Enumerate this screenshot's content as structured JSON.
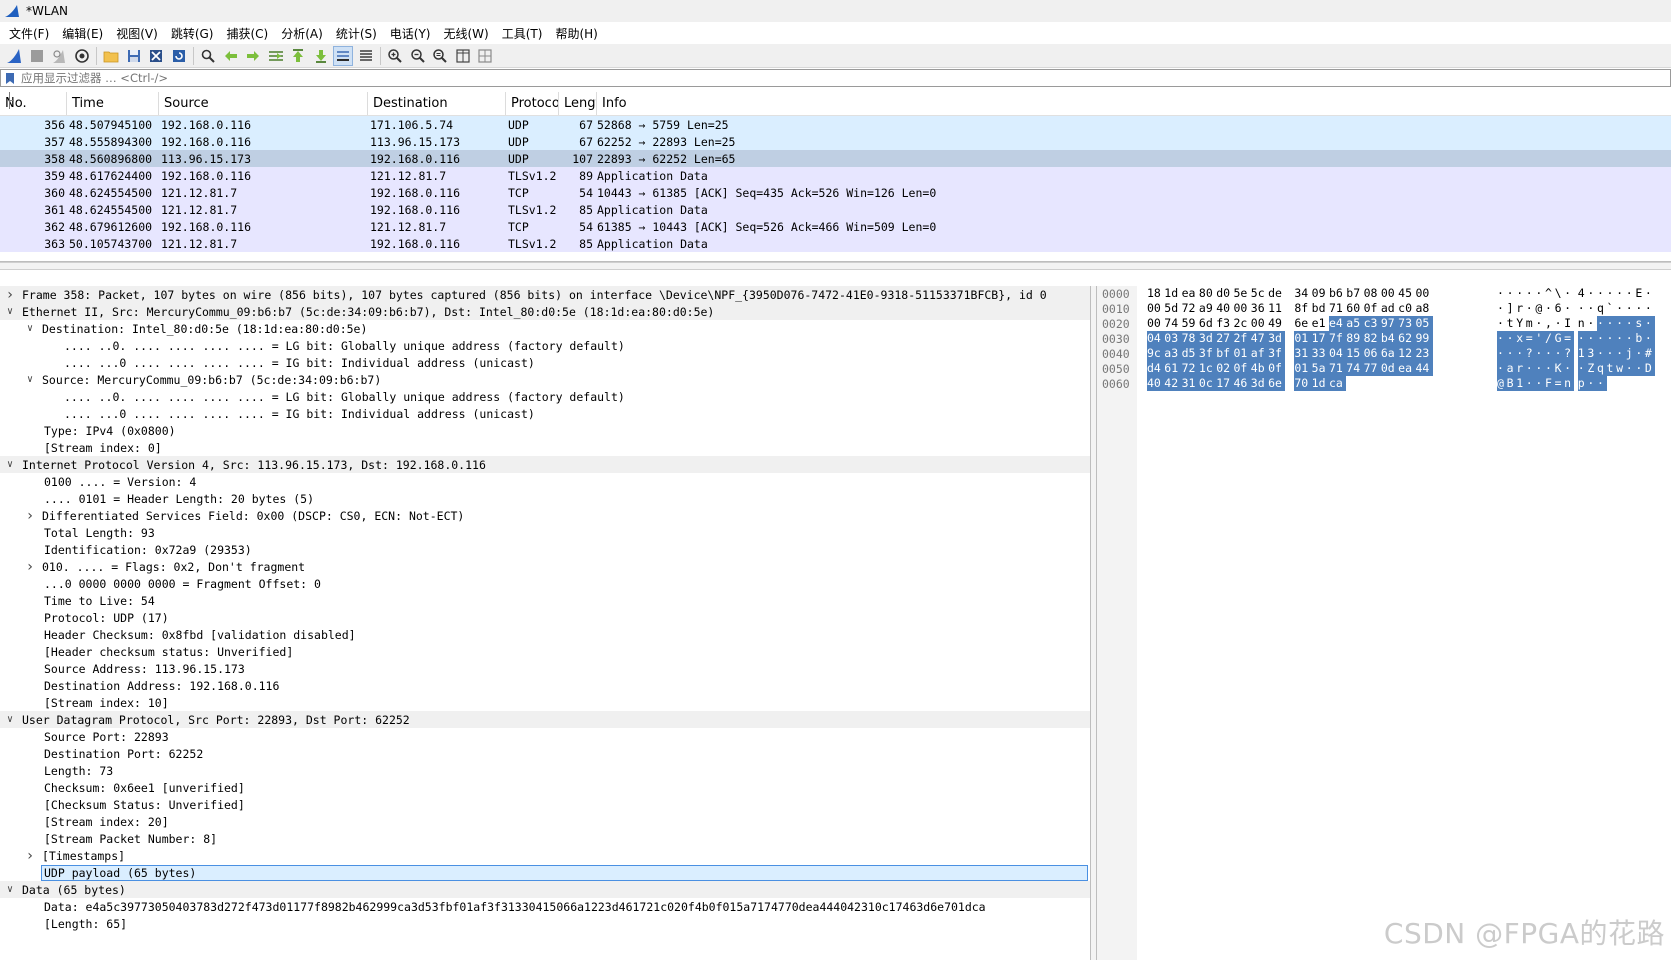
{
  "window": {
    "title": "*WLAN"
  },
  "menu": [
    "文件(F)",
    "编辑(E)",
    "视图(V)",
    "跳转(G)",
    "捕获(C)",
    "分析(A)",
    "统计(S)",
    "电话(Y)",
    "无线(W)",
    "工具(T)",
    "帮助(H)"
  ],
  "toolbar": {
    "icons": [
      "shark-fin-start-icon",
      "stop-square-icon",
      "restart-fin-icon",
      "capture-options-gear-icon",
      "open-folder-icon",
      "save-file-icon",
      "close-file-icon",
      "reload-file-icon",
      "find-packet-magnifier-icon",
      "go-back-arrow-icon",
      "go-forward-arrow-icon",
      "go-to-packet-icon",
      "go-first-packet-icon",
      "go-last-packet-icon",
      "autoscroll-icon",
      "colorize-icon",
      "zoom-in-icon",
      "zoom-out-icon",
      "normal-size-icon",
      "resize-columns-icon",
      "expand-columns-icon"
    ]
  },
  "filter": {
    "placeholder": "应用显示过滤器 … <Ctrl-/>"
  },
  "packet_list": {
    "columns": [
      "No.",
      "Time",
      "Source",
      "Destination",
      "Protoco",
      "Lengt",
      "Info"
    ],
    "rows": [
      {
        "no": "356",
        "time": "48.507945100",
        "src": "192.168.0.116",
        "dst": "171.106.5.74",
        "proto": "UDP",
        "len": "67",
        "info": "52868 → 5759 Len=25",
        "kind": "udp",
        "rel": "line"
      },
      {
        "no": "357",
        "time": "48.555894300",
        "src": "192.168.0.116",
        "dst": "113.96.15.173",
        "proto": "UDP",
        "len": "67",
        "info": "62252 → 22893 Len=25",
        "kind": "udp",
        "rel": "line"
      },
      {
        "no": "358",
        "time": "48.560896800",
        "src": "113.96.15.173",
        "dst": "192.168.0.116",
        "proto": "UDP",
        "len": "107",
        "info": "22893 → 62252 Len=65",
        "kind": "sel",
        "rel": "end"
      },
      {
        "no": "359",
        "time": "48.617624400",
        "src": "192.168.0.116",
        "dst": "121.12.81.7",
        "proto": "TLSv1.2",
        "len": "89",
        "info": "Application Data",
        "kind": "tcp",
        "rel": ""
      },
      {
        "no": "360",
        "time": "48.624554500",
        "src": "121.12.81.7",
        "dst": "192.168.0.116",
        "proto": "TCP",
        "len": "54",
        "info": "10443 → 61385 [ACK] Seq=435 Ack=526 Win=126 Len=0",
        "kind": "tcp",
        "rel": ""
      },
      {
        "no": "361",
        "time": "48.624554500",
        "src": "121.12.81.7",
        "dst": "192.168.0.116",
        "proto": "TLSv1.2",
        "len": "85",
        "info": "Application Data",
        "kind": "tcp",
        "rel": ""
      },
      {
        "no": "362",
        "time": "48.679612600",
        "src": "192.168.0.116",
        "dst": "121.12.81.7",
        "proto": "TCP",
        "len": "54",
        "info": "61385 → 10443 [ACK] Seq=526 Ack=466 Win=509 Len=0",
        "kind": "tcp",
        "rel": ""
      },
      {
        "no": "363",
        "time": "50.105743700",
        "src": "121.12.81.7",
        "dst": "192.168.0.116",
        "proto": "TLSv1.2",
        "len": "85",
        "info": "Application Data",
        "kind": "tcp",
        "rel": ""
      }
    ]
  },
  "details": [
    {
      "level": 0,
      "arrow": "collapsed",
      "top": true,
      "text": "Frame 358: Packet, 107 bytes on wire (856 bits), 107 bytes captured (856 bits) on interface \\Device\\NPF_{3950D076-7472-41E0-9318-51153371BFCB}, id 0"
    },
    {
      "level": 0,
      "arrow": "expanded",
      "top": true,
      "text": "Ethernet II, Src: MercuryCommu_09:b6:b7 (5c:de:34:09:b6:b7), Dst: Intel_80:d0:5e (18:1d:ea:80:d0:5e)"
    },
    {
      "level": 1,
      "arrow": "expanded",
      "text": "Destination: Intel_80:d0:5e (18:1d:ea:80:d0:5e)"
    },
    {
      "level": 2,
      "arrow": "",
      "text": ".... ..0. .... .... .... .... = LG bit: Globally unique address (factory default)"
    },
    {
      "level": 2,
      "arrow": "",
      "text": ".... ...0 .... .... .... .... = IG bit: Individual address (unicast)"
    },
    {
      "level": 1,
      "arrow": "expanded",
      "text": "Source: MercuryCommu_09:b6:b7 (5c:de:34:09:b6:b7)"
    },
    {
      "level": 2,
      "arrow": "",
      "text": ".... ..0. .... .... .... .... = LG bit: Globally unique address (factory default)"
    },
    {
      "level": 2,
      "arrow": "",
      "text": ".... ...0 .... .... .... .... = IG bit: Individual address (unicast)"
    },
    {
      "level": 1,
      "arrow": "",
      "text": "Type: IPv4 (0x0800)"
    },
    {
      "level": 1,
      "arrow": "",
      "text": "[Stream index: 0]"
    },
    {
      "level": 0,
      "arrow": "expanded",
      "top": true,
      "text": "Internet Protocol Version 4, Src: 113.96.15.173, Dst: 192.168.0.116"
    },
    {
      "level": 1,
      "arrow": "",
      "text": "0100 .... = Version: 4"
    },
    {
      "level": 1,
      "arrow": "",
      "text": ".... 0101 = Header Length: 20 bytes (5)"
    },
    {
      "level": 1,
      "arrow": "collapsed",
      "text": "Differentiated Services Field: 0x00 (DSCP: CS0, ECN: Not-ECT)"
    },
    {
      "level": 1,
      "arrow": "",
      "text": "Total Length: 93"
    },
    {
      "level": 1,
      "arrow": "",
      "text": "Identification: 0x72a9 (29353)"
    },
    {
      "level": 1,
      "arrow": "collapsed",
      "text": "010. .... = Flags: 0x2, Don't fragment"
    },
    {
      "level": 1,
      "arrow": "",
      "text": "...0 0000 0000 0000 = Fragment Offset: 0"
    },
    {
      "level": 1,
      "arrow": "",
      "text": "Time to Live: 54"
    },
    {
      "level": 1,
      "arrow": "",
      "text": "Protocol: UDP (17)"
    },
    {
      "level": 1,
      "arrow": "",
      "text": "Header Checksum: 0x8fbd [validation disabled]"
    },
    {
      "level": 1,
      "arrow": "",
      "text": "[Header checksum status: Unverified]"
    },
    {
      "level": 1,
      "arrow": "",
      "text": "Source Address: 113.96.15.173"
    },
    {
      "level": 1,
      "arrow": "",
      "text": "Destination Address: 192.168.0.116"
    },
    {
      "level": 1,
      "arrow": "",
      "text": "[Stream index: 10]"
    },
    {
      "level": 0,
      "arrow": "expanded",
      "top": true,
      "text": "User Datagram Protocol, Src Port: 22893, Dst Port: 62252"
    },
    {
      "level": 1,
      "arrow": "",
      "text": "Source Port: 22893"
    },
    {
      "level": 1,
      "arrow": "",
      "text": "Destination Port: 62252"
    },
    {
      "level": 1,
      "arrow": "",
      "text": "Length: 73"
    },
    {
      "level": 1,
      "arrow": "",
      "text": "Checksum: 0x6ee1 [unverified]"
    },
    {
      "level": 1,
      "arrow": "",
      "text": "[Checksum Status: Unverified]"
    },
    {
      "level": 1,
      "arrow": "",
      "text": "[Stream index: 20]"
    },
    {
      "level": 1,
      "arrow": "",
      "text": "[Stream Packet Number: 8]"
    },
    {
      "level": 1,
      "arrow": "collapsed",
      "text": "[Timestamps]"
    },
    {
      "level": 1,
      "arrow": "",
      "text": "UDP payload (65 bytes)",
      "highlight": true
    },
    {
      "level": 0,
      "arrow": "expanded",
      "top": true,
      "text": "Data (65 bytes)"
    },
    {
      "level": 1,
      "arrow": "",
      "text": "Data: e4a5c39773050403783d272f473d01177f8982b462999ca3d53fbf01af3f31330415066a1223d461721c020f4b0f015a7174770dea444042310c17463d6e701dca"
    },
    {
      "level": 1,
      "arrow": "",
      "text": "[Length: 65]"
    }
  ],
  "bytes": {
    "rows": [
      {
        "offset": "0000",
        "hex": [
          "18",
          "1d",
          "ea",
          "80",
          "d0",
          "5e",
          "5c",
          "de",
          "34",
          "09",
          "b6",
          "b7",
          "08",
          "00",
          "45",
          "00"
        ],
        "ascii": [
          "·",
          "·",
          "·",
          "·",
          "·",
          "^",
          "\\",
          "·",
          "4",
          "·",
          "·",
          "·",
          "·",
          "·",
          "E",
          "·"
        ],
        "sel_from": 99
      },
      {
        "offset": "0010",
        "hex": [
          "00",
          "5d",
          "72",
          "a9",
          "40",
          "00",
          "36",
          "11",
          "8f",
          "bd",
          "71",
          "60",
          "0f",
          "ad",
          "c0",
          "a8"
        ],
        "ascii": [
          "·",
          "]",
          "r",
          "·",
          "@",
          "·",
          "6",
          "·",
          "·",
          "·",
          "q",
          "`",
          "·",
          "·",
          "·",
          "·"
        ],
        "sel_from": 99
      },
      {
        "offset": "0020",
        "hex": [
          "00",
          "74",
          "59",
          "6d",
          "f3",
          "2c",
          "00",
          "49",
          "6e",
          "e1",
          "e4",
          "a5",
          "c3",
          "97",
          "73",
          "05"
        ],
        "ascii": [
          "·",
          "t",
          "Y",
          "m",
          "·",
          ",",
          "·",
          "I",
          "n",
          "·",
          "·",
          "·",
          "·",
          "·",
          "s",
          "·"
        ],
        "sel_from": 10
      },
      {
        "offset": "0030",
        "hex": [
          "04",
          "03",
          "78",
          "3d",
          "27",
          "2f",
          "47",
          "3d",
          "01",
          "17",
          "7f",
          "89",
          "82",
          "b4",
          "62",
          "99"
        ],
        "ascii": [
          "·",
          "·",
          "x",
          "=",
          "'",
          "/",
          "G",
          "=",
          "·",
          "·",
          "·",
          "·",
          "·",
          "·",
          "b",
          "·"
        ],
        "sel_from": 0
      },
      {
        "offset": "0040",
        "hex": [
          "9c",
          "a3",
          "d5",
          "3f",
          "bf",
          "01",
          "af",
          "3f",
          "31",
          "33",
          "04",
          "15",
          "06",
          "6a",
          "12",
          "23"
        ],
        "ascii": [
          "·",
          "·",
          "·",
          "?",
          "·",
          "·",
          "·",
          "?",
          "1",
          "3",
          "·",
          "·",
          "·",
          "j",
          "·",
          "#"
        ],
        "sel_from": 0
      },
      {
        "offset": "0050",
        "hex": [
          "d4",
          "61",
          "72",
          "1c",
          "02",
          "0f",
          "4b",
          "0f",
          "01",
          "5a",
          "71",
          "74",
          "77",
          "0d",
          "ea",
          "44"
        ],
        "ascii": [
          "·",
          "a",
          "r",
          "·",
          "·",
          "·",
          "K",
          "·",
          "·",
          "Z",
          "q",
          "t",
          "w",
          "·",
          "·",
          "D"
        ],
        "sel_from": 0
      },
      {
        "offset": "0060",
        "hex": [
          "40",
          "42",
          "31",
          "0c",
          "17",
          "46",
          "3d",
          "6e",
          "70",
          "1d",
          "ca"
        ],
        "ascii": [
          "@",
          "B",
          "1",
          "·",
          "·",
          "F",
          "=",
          "n",
          "p",
          "·",
          "·"
        ],
        "sel_from": 0
      }
    ]
  },
  "colors": {
    "udp_row": "#daeeff",
    "tcp_row": "#e7e6ff",
    "selected_row": "#bfcfe3",
    "byte_highlight": "#4f81bd"
  },
  "watermark": "CSDN @FPGA的花路"
}
